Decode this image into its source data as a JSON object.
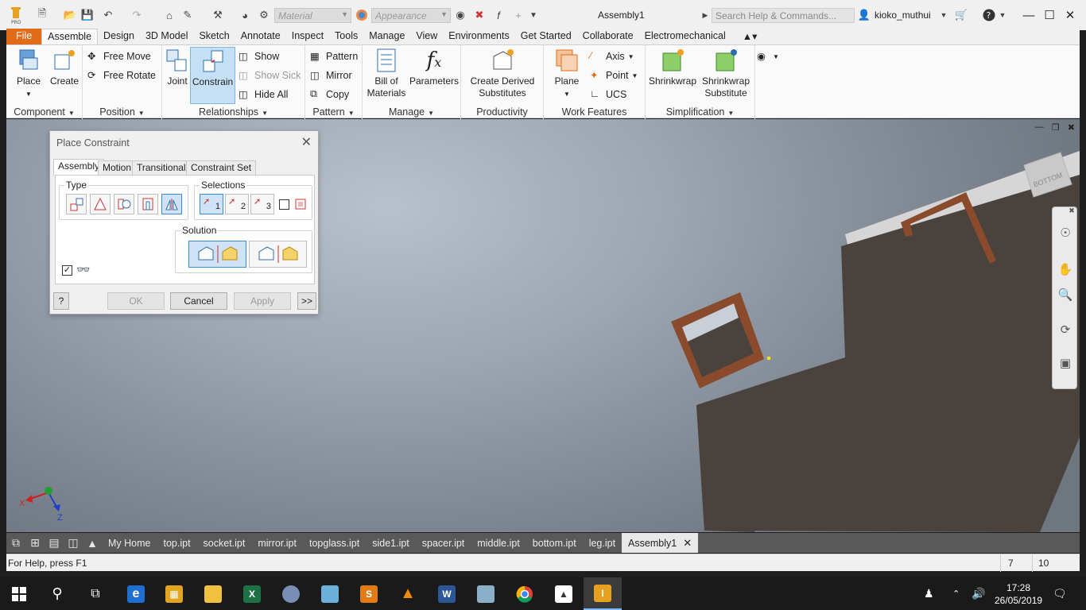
{
  "app": {
    "title": "Assembly1",
    "material_placeholder": "Material",
    "appearance_placeholder": "Appearance",
    "search_placeholder": "Search Help & Commands...",
    "user": "kioko_muthui"
  },
  "ribbon_tabs": [
    "File",
    "Assemble",
    "Design",
    "3D Model",
    "Sketch",
    "Annotate",
    "Inspect",
    "Tools",
    "Manage",
    "View",
    "Environments",
    "Get Started",
    "Collaborate",
    "Electromechanical"
  ],
  "ribbon_active_tab": "Assemble",
  "ribbon": {
    "component": {
      "label": "Component",
      "place": "Place",
      "create": "Create"
    },
    "position": {
      "label": "Position",
      "free_move": "Free Move",
      "free_rotate": "Free Rotate"
    },
    "relationships": {
      "label": "Relationships",
      "joint": "Joint",
      "constrain": "Constrain",
      "show": "Show",
      "show_sick": "Show Sick",
      "hide_all": "Hide All"
    },
    "pattern": {
      "label": "Pattern",
      "pattern": "Pattern",
      "mirror": "Mirror",
      "copy": "Copy"
    },
    "manage": {
      "label": "Manage",
      "bom_line1": "Bill of",
      "bom_line2": "Materials",
      "parameters": "Parameters"
    },
    "productivity": {
      "label": "Productivity",
      "line1": "Create Derived",
      "line2": "Substitutes"
    },
    "work_features": {
      "label": "Work Features",
      "plane": "Plane",
      "axis": "Axis",
      "point": "Point",
      "ucs": "UCS"
    },
    "simplification": {
      "label": "Simplification",
      "shrinkwrap": "Shrinkwrap",
      "shrinkwrap_sub_line1": "Shrinkwrap",
      "shrinkwrap_sub_line2": "Substitute"
    }
  },
  "dialog": {
    "title": "Place Constraint",
    "tabs": [
      "Assembly",
      "Motion",
      "Transitional",
      "Constraint Set"
    ],
    "active_tab": "Assembly",
    "type_label": "Type",
    "selections_label": "Selections",
    "selection_buttons": [
      "1",
      "2",
      "3"
    ],
    "solution_label": "Solution",
    "preview_checked": true,
    "ok": "OK",
    "cancel": "Cancel",
    "apply": "Apply",
    "more": ">>"
  },
  "viewcube_label": "BOTTOM",
  "triad": {
    "x": "X",
    "z": "Z"
  },
  "doc_tabs": [
    "My Home",
    "top.ipt",
    "socket.ipt",
    "mirror.ipt",
    "topglass.ipt",
    "side1.ipt",
    "spacer.ipt",
    "middle.ipt",
    "bottom.ipt",
    "leg.ipt",
    "Assembly1"
  ],
  "active_doc_tab": "Assembly1",
  "status": {
    "help": "For Help, press F1",
    "count1": "7",
    "count2": "10"
  },
  "taskbar": {
    "apps": [
      "start",
      "search",
      "task-view",
      "edge",
      "store",
      "file-explorer",
      "excel",
      "paint",
      "paint3d",
      "sublime",
      "vlc",
      "word",
      "control-panel",
      "chrome",
      "photos",
      "inventor"
    ],
    "time": "17:28",
    "date": "26/05/2019"
  },
  "colors": {
    "accent": "#e06c1a",
    "selected": "#c5dff5",
    "part_body": "#4a423d",
    "frame_brown": "#8a4a2c"
  }
}
